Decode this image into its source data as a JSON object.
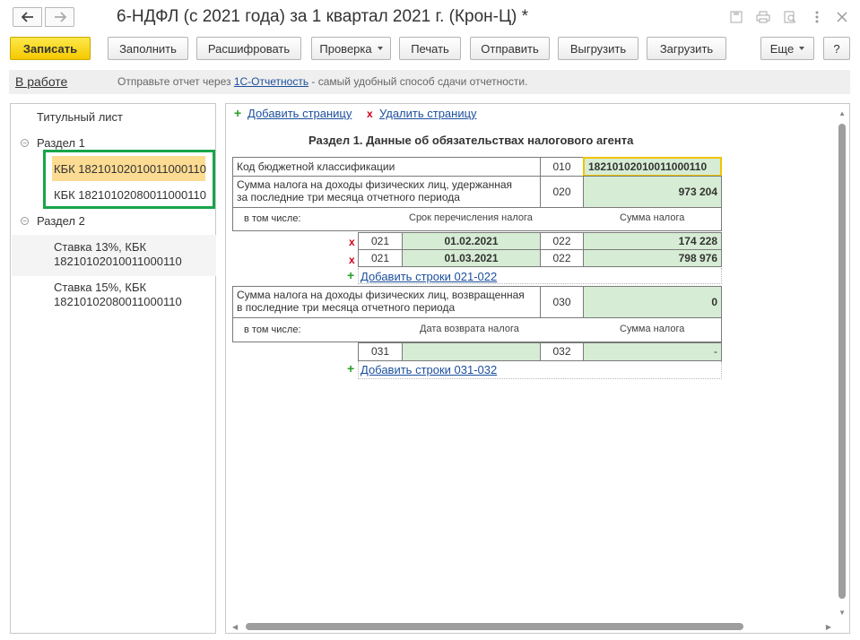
{
  "window": {
    "title": "6-НДФЛ (с 2021 года) за 1 квартал 2021 г. (Крон-Ц) *"
  },
  "toolbar": {
    "save": "Записать",
    "fill": "Заполнить",
    "decode": "Расшифровать",
    "check": "Проверка",
    "print": "Печать",
    "send": "Отправить",
    "export": "Выгрузить",
    "import": "Загрузить",
    "more": "Еще",
    "help": "?"
  },
  "info": {
    "status": "В работе",
    "hint_prefix": "Отправьте отчет через ",
    "hint_link": "1С-Отчетность",
    "hint_suffix": " - самый удобный способ сдачи отчетности."
  },
  "tree": {
    "title_page": "Титульный лист",
    "section1": "Раздел 1",
    "kbk1": "КБК 18210102010011000110",
    "kbk2": "КБК 18210102080011000110",
    "section2": "Раздел 2",
    "rate13_line1": "Ставка 13%, КБК",
    "rate13_line2": "18210102010011000110",
    "rate15_line1": "Ставка 15%, КБК",
    "rate15_line2": "18210102080011000110"
  },
  "form": {
    "add_page": "Добавить страницу",
    "delete_page": "Удалить страницу",
    "heading": "Раздел 1. Данные об обязательствах налогового агента",
    "kbk_label": "Код бюджетной классификации",
    "kbk_code": "010",
    "kbk_value": "18210102010011000110",
    "withheld_line1": "Сумма налога на доходы физических лиц, удержанная",
    "withheld_line2": "за последние три месяца отчетного периода",
    "withheld_code": "020",
    "withheld_value": "973 204",
    "including": "в том числе:",
    "transfer_date_header": "Срок перечисления налога",
    "tax_amount_header": "Сумма налога",
    "rows_021": [
      {
        "code_a": "021",
        "date": "01.02.2021",
        "code_b": "022",
        "amount": "174 228"
      },
      {
        "code_a": "021",
        "date": "01.03.2021",
        "code_b": "022",
        "amount": "798 976"
      }
    ],
    "add_rows_021": "Добавить строки 021-022",
    "returned_line1": "Сумма налога на доходы физических лиц, возвращенная",
    "returned_line2": "в последние три месяца отчетного периода",
    "returned_code": "030",
    "returned_value": "0",
    "including2": "в том числе:",
    "return_date_header": "Дата возврата налога",
    "tax_amount_header2": "Сумма налога",
    "row_031": {
      "code_a": "031",
      "date": "",
      "code_b": "032",
      "amount": "-"
    },
    "add_rows_031": "Добавить строки 031-032"
  }
}
